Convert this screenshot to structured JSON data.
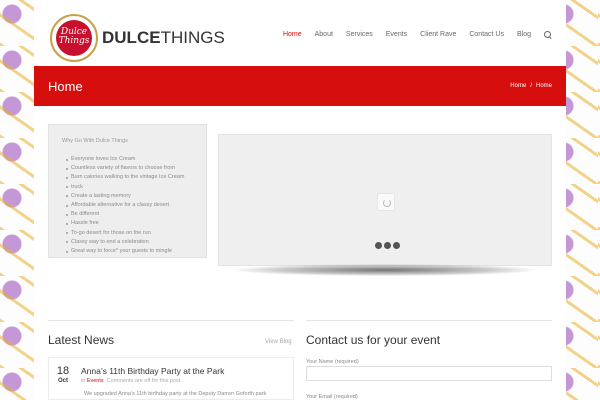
{
  "brand": {
    "logo_text_script": "Dulce Things",
    "wordmark_bold": "DULCE",
    "wordmark_light": "THINGS"
  },
  "nav": {
    "items": [
      "Home",
      "About",
      "Services",
      "Events",
      "Client Rave",
      "Contact Us",
      "Blog"
    ],
    "active": "Home",
    "search_icon": "search-icon"
  },
  "page_title": "Home",
  "breadcrumb": {
    "first": "Home",
    "separator": "/",
    "current": "Home"
  },
  "why": {
    "title": "Why Go With Dulce Things",
    "items": [
      "Everyone loves Ice Cream",
      "Countless variety of flavors to choose from",
      "Burn calories walking to the vintage Ice Cream",
      "truck",
      "Create a lasting memory",
      "Affordable alternative for a classy desert",
      "Be different",
      "Hassle free",
      "To-go desert for those on the run",
      "Classy way to end a celebration",
      "Great way to force* your guests to mingle"
    ]
  },
  "news": {
    "heading": "Latest News",
    "view_all": "View Blog",
    "item": {
      "day": "18",
      "month": "Oct",
      "title": "Anna’s 11th Birthday Party at the Park",
      "meta_prefix": "in",
      "category": "Events",
      "comments": "Comments are off for this post.",
      "excerpt": "We upgraded Anna’s 11th birthday party at the Deputy Darren Goforth park"
    }
  },
  "contact": {
    "heading": "Contact us for your event",
    "name_label": "Your Name (required)",
    "email_label": "Your Email (required)"
  },
  "colors": {
    "accent": "#d60e0e",
    "panel": "#eeeeee"
  }
}
